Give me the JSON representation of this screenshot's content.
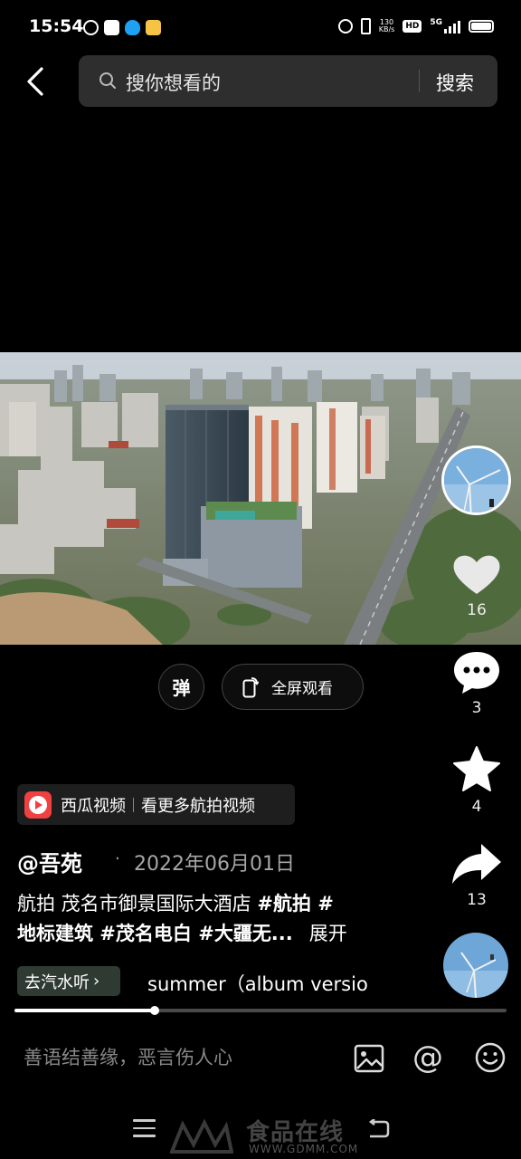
{
  "status_bar": {
    "time": "15:54",
    "net_speed_value": "130",
    "net_speed_unit": "KB/s",
    "hd_label": "HD",
    "network": "5G",
    "app_icons": [
      "k-icon",
      "m-icon",
      "qq-icon",
      "58-icon"
    ]
  },
  "search": {
    "placeholder": "搜你想看的",
    "button_label": "搜索"
  },
  "video": {
    "danmaku_label": "弹",
    "fullscreen_label": "全屏观看",
    "progress_fraction": 0.285
  },
  "actions": {
    "like_count": "16",
    "comment_count": "3",
    "favorite_count": "4",
    "share_count": "13"
  },
  "source": {
    "name": "西瓜视频",
    "more_label": "看更多航拍视频"
  },
  "post": {
    "author": "@吾苑",
    "dot": "·",
    "date": "2022年06月01日",
    "line1_text": "航拍 茂名市御景国际大酒店 ",
    "line1_tag": "#航拍 #",
    "line2_tags": "地标建筑 #茂名电白 #大疆无...",
    "expand_label": "展开"
  },
  "music": {
    "listen_label": "去汽水听",
    "listen_chevron": "›",
    "title": "summer（album versio"
  },
  "comment_bar": {
    "placeholder": "善语结善缘，恶言伤人心",
    "at_symbol": "@"
  },
  "watermark": {
    "text": "食品在线",
    "url": "WWW.GDMM.COM"
  },
  "colors": {
    "background": "#000000",
    "search_bg": "#2e2e2e",
    "listen_tag_bg": "#2f3b32",
    "xigua_red": "#f04142"
  }
}
